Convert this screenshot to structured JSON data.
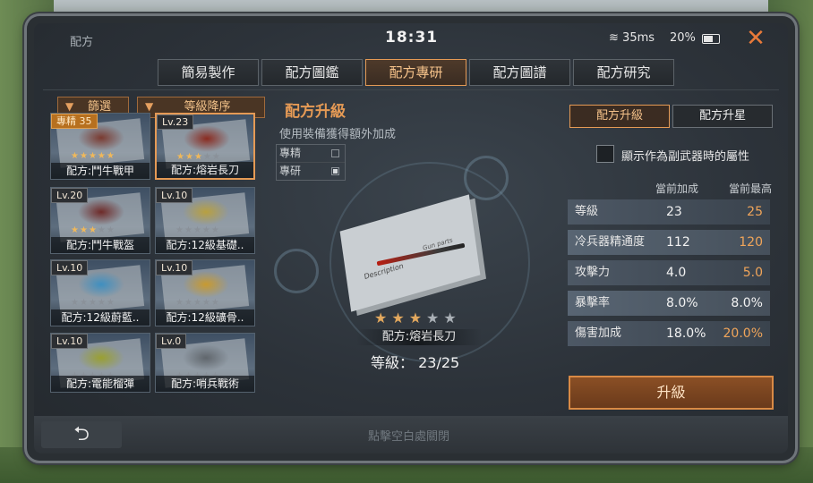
{
  "status": {
    "app_title": "配方",
    "time": "18:31",
    "wifi_speed": "35ms",
    "battery": "20%",
    "close_icon": "close-icon"
  },
  "tabs": [
    {
      "label": "簡易製作",
      "active": false
    },
    {
      "label": "配方圖鑑",
      "active": false
    },
    {
      "label": "配方專研",
      "active": true
    },
    {
      "label": "配方圖譜",
      "active": false
    },
    {
      "label": "配方研究",
      "active": false
    }
  ],
  "left_panel": {
    "filter_label": "篩選",
    "sort_label": "等級降序",
    "cards": [
      {
        "level": "專精 35",
        "gold": true,
        "stars": 5,
        "filled": 5,
        "name": "配方:鬥牛戰甲",
        "selected": false
      },
      {
        "level": "Lv.23",
        "gold": false,
        "stars": 5,
        "filled": 3,
        "name": "配方:熔岩長刀",
        "selected": true
      },
      {
        "level": "Lv.20",
        "gold": false,
        "stars": 5,
        "filled": 3,
        "name": "配方:鬥牛戰盔",
        "selected": false
      },
      {
        "level": "Lv.10",
        "gold": false,
        "stars": 5,
        "filled": 0,
        "name": "配方:12級基礎..",
        "selected": false
      },
      {
        "level": "Lv.10",
        "gold": false,
        "stars": 5,
        "filled": 0,
        "name": "配方:12級蔚藍..",
        "selected": false
      },
      {
        "level": "Lv.10",
        "gold": false,
        "stars": 5,
        "filled": 0,
        "name": "配方:12級礦骨..",
        "selected": false
      },
      {
        "level": "Lv.10",
        "gold": false,
        "stars": 5,
        "filled": 0,
        "name": "配方:電能榴彈",
        "selected": false
      },
      {
        "level": "Lv.0",
        "gold": false,
        "stars": 5,
        "filled": 0,
        "name": "配方:哨兵戰術",
        "selected": false
      }
    ]
  },
  "middle_panel": {
    "title": "配方升級",
    "subtitle": "使用裝備獲得額外加成",
    "options": [
      {
        "label": "專精",
        "checked": false
      },
      {
        "label": "專研",
        "checked": true
      }
    ],
    "blueprint_desc": "Description",
    "blueprint_parts": "Gun parts",
    "item_stars_total": 5,
    "item_stars_filled": 3,
    "item_name": "配方:熔岩長刀",
    "item_level": "等級： 23/25"
  },
  "right_panel": {
    "tab_upgrade": "配方升級",
    "tab_star": "配方升星",
    "checkbox_label": "顯示作為副武器時的屬性",
    "col_current": "當前加成",
    "col_max": "當前最高",
    "stats": [
      {
        "label": "等級",
        "current": "23",
        "max": "25",
        "highlight": true
      },
      {
        "label": "冷兵器精通度",
        "current": "112",
        "max": "120",
        "highlight": true
      },
      {
        "label": "攻擊力",
        "current": "4.0",
        "max": "5.0",
        "highlight": true
      },
      {
        "label": "暴擊率",
        "current": "8.0%",
        "max": "8.0%",
        "highlight": false
      },
      {
        "label": "傷害加成",
        "current": "18.0%",
        "max": "20.0%",
        "highlight": true
      }
    ],
    "upgrade_button": "升級"
  },
  "bottom": {
    "back_icon": "back-arrow-icon",
    "hint": "點擊空白處關閉"
  },
  "colors": {
    "accent": "#e59a55",
    "highlight_value": "#f0a55a"
  }
}
